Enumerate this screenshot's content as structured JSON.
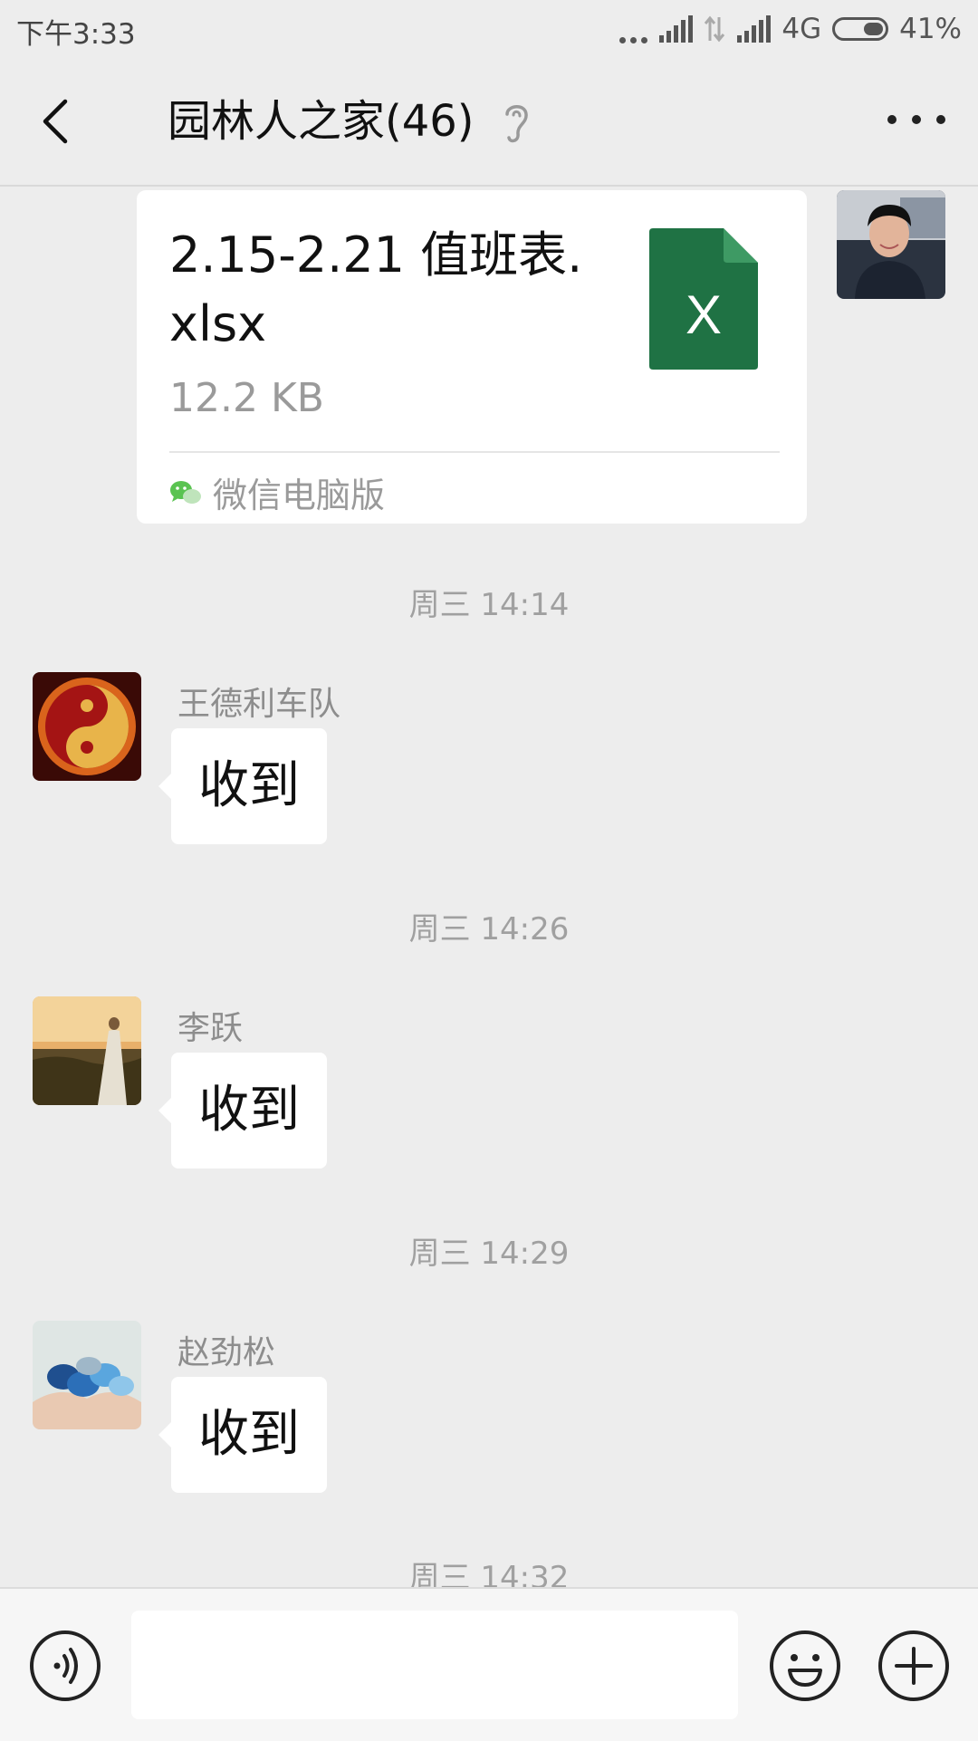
{
  "status_bar": {
    "time": "下午3:33",
    "network": "4G",
    "battery_percent": "41%",
    "battery_level": 0.41
  },
  "header": {
    "title": "园林人之家(46)"
  },
  "file_message": {
    "file_name": "2.15-2.21 值班表.xlsx",
    "file_size": "12.2 KB",
    "file_icon_letter": "X",
    "source": "微信电脑版",
    "icon_color": "#1f7244"
  },
  "messages": [
    {
      "time": "周三 14:14",
      "sender": "王德利车队",
      "text": "收到"
    },
    {
      "time": "周三 14:26",
      "sender": "李跃",
      "text": "收到"
    },
    {
      "time": "周三 14:29",
      "sender": "赵劲松",
      "text": "收到"
    }
  ],
  "trailing_time": "周三 14:32",
  "input_bar": {
    "placeholder": ""
  },
  "colors": {
    "background": "#ededed",
    "bubble": "#ffffff",
    "excel_green": "#1f7244",
    "wechat_green": "#5ac351"
  }
}
